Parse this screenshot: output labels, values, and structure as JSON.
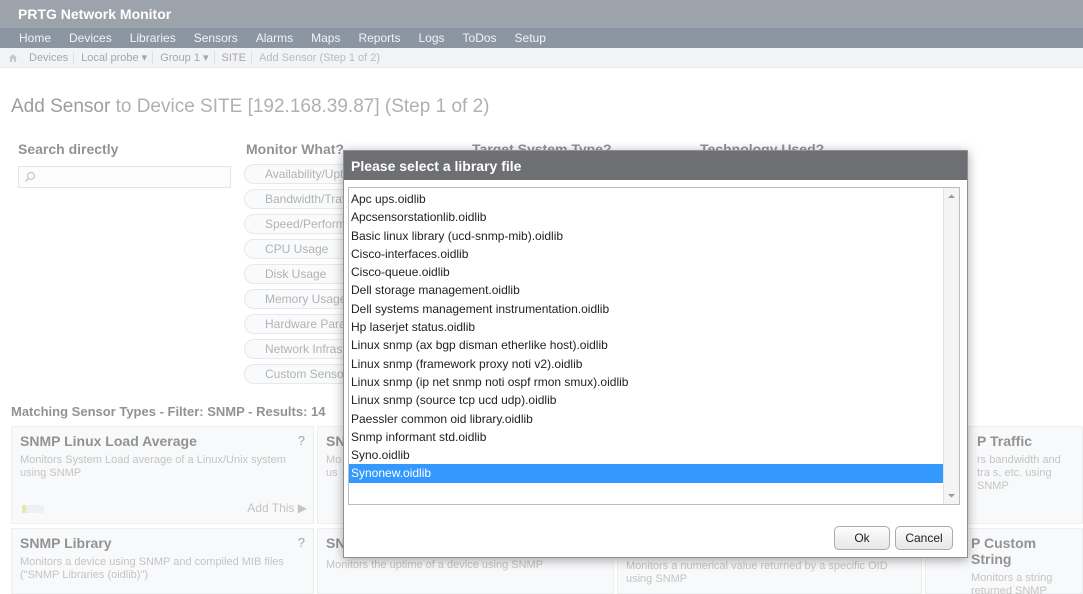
{
  "app": {
    "title": "PRTG Network Monitor"
  },
  "nav": [
    "Home",
    "Devices",
    "Libraries",
    "Sensors",
    "Alarms",
    "Maps",
    "Reports",
    "Logs",
    "ToDos",
    "Setup"
  ],
  "breadcrumb": [
    "Devices",
    "Local probe ▾",
    "Group 1 ▾",
    "SITE"
  ],
  "breadcrumb_current": "Add Sensor (Step 1 of 2)",
  "page": {
    "title_prefix": "Add Sensor",
    "title_suffix": " to Device SITE [192.168.39.87] (Step 1 of 2)",
    "search_heading": "Search directly",
    "monitor_heading": "Monitor What?",
    "target_heading": "Target System Type?",
    "tech_heading": "Technology Used?",
    "monitor_options": [
      "Availability/Uptime",
      "Bandwidth/Traffic",
      "Speed/Performance",
      "CPU Usage",
      "Disk Usage",
      "Memory Usage",
      "Hardware Parameters",
      "Network Infrastructure",
      "Custom Sensors"
    ],
    "matching": "Matching Sensor Types - Filter: SNMP - Results: 14"
  },
  "cards": [
    {
      "title": "SNMP Linux Load Average",
      "desc": "Monitors System Load average of a Linux/Unix system using SNMP",
      "q": "?",
      "add": "Add This ▶"
    },
    {
      "title": "SNMP Library",
      "desc": "Monitors a device using SNMP and compiled MIB files (\"SNMP Libraries (oidlib)\")",
      "q": "?"
    },
    {
      "title": "SN",
      "desc": "Mo us",
      "q": ""
    },
    {
      "title": "SN",
      "desc": "Monitors the uptime of a device using SNMP",
      "q": ""
    },
    {
      "title": "P Traffic",
      "desc": "rs bandwidth and tra s, etc. using SNMP",
      "q": ""
    },
    {
      "title": "P Custom String",
      "desc": "Monitors a string returned SNMP",
      "q": ""
    },
    {
      "title": "",
      "desc": "Monitors a numerical value returned by a specific OID using SNMP",
      "q": ""
    }
  ],
  "dialog": {
    "title": "Please select a library file",
    "files": [
      "Apc ups.oidlib",
      "Apcsensorstationlib.oidlib",
      "Basic linux library (ucd-snmp-mib).oidlib",
      "Cisco-interfaces.oidlib",
      "Cisco-queue.oidlib",
      "Dell storage management.oidlib",
      "Dell systems management instrumentation.oidlib",
      "Hp laserjet status.oidlib",
      "Linux snmp (ax bgp disman etherlike host).oidlib",
      "Linux snmp (framework proxy noti v2).oidlib",
      "Linux snmp (ip net snmp noti ospf rmon smux).oidlib",
      "Linux snmp (source tcp ucd udp).oidlib",
      "Paessler common oid library.oidlib",
      "Snmp informant std.oidlib",
      "Syno.oidlib",
      "Synonew.oidlib"
    ],
    "selected_index": 15,
    "ok_label": "Ok",
    "cancel_label": "Cancel"
  },
  "colors": {
    "selection": "#3399ff",
    "dialog_header": "#6e6f72",
    "navbar": "#3a4a5f"
  }
}
